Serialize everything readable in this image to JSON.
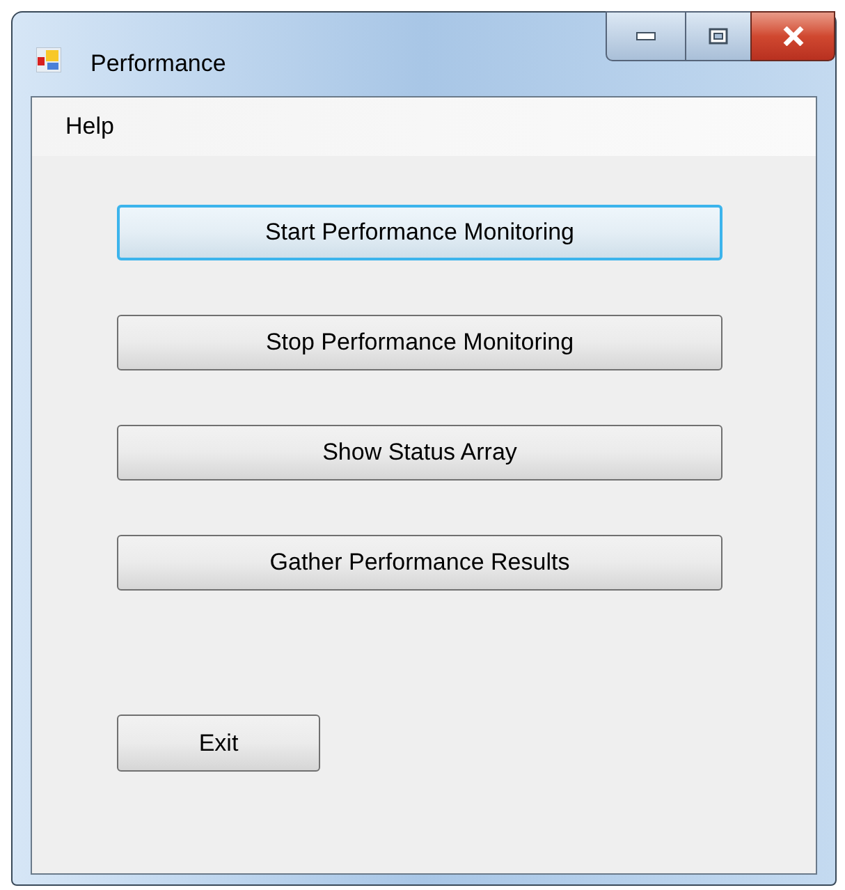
{
  "window": {
    "title": "Performance"
  },
  "menu": [
    {
      "label": "Help"
    }
  ],
  "buttons": [
    {
      "label": "Start Performance Monitoring",
      "focused": true
    },
    {
      "label": "Stop Performance Monitoring",
      "focused": false
    },
    {
      "label": "Show Status Array",
      "focused": false
    },
    {
      "label": "Gather Performance Results",
      "focused": false
    }
  ],
  "exit_button": {
    "label": "Exit"
  }
}
